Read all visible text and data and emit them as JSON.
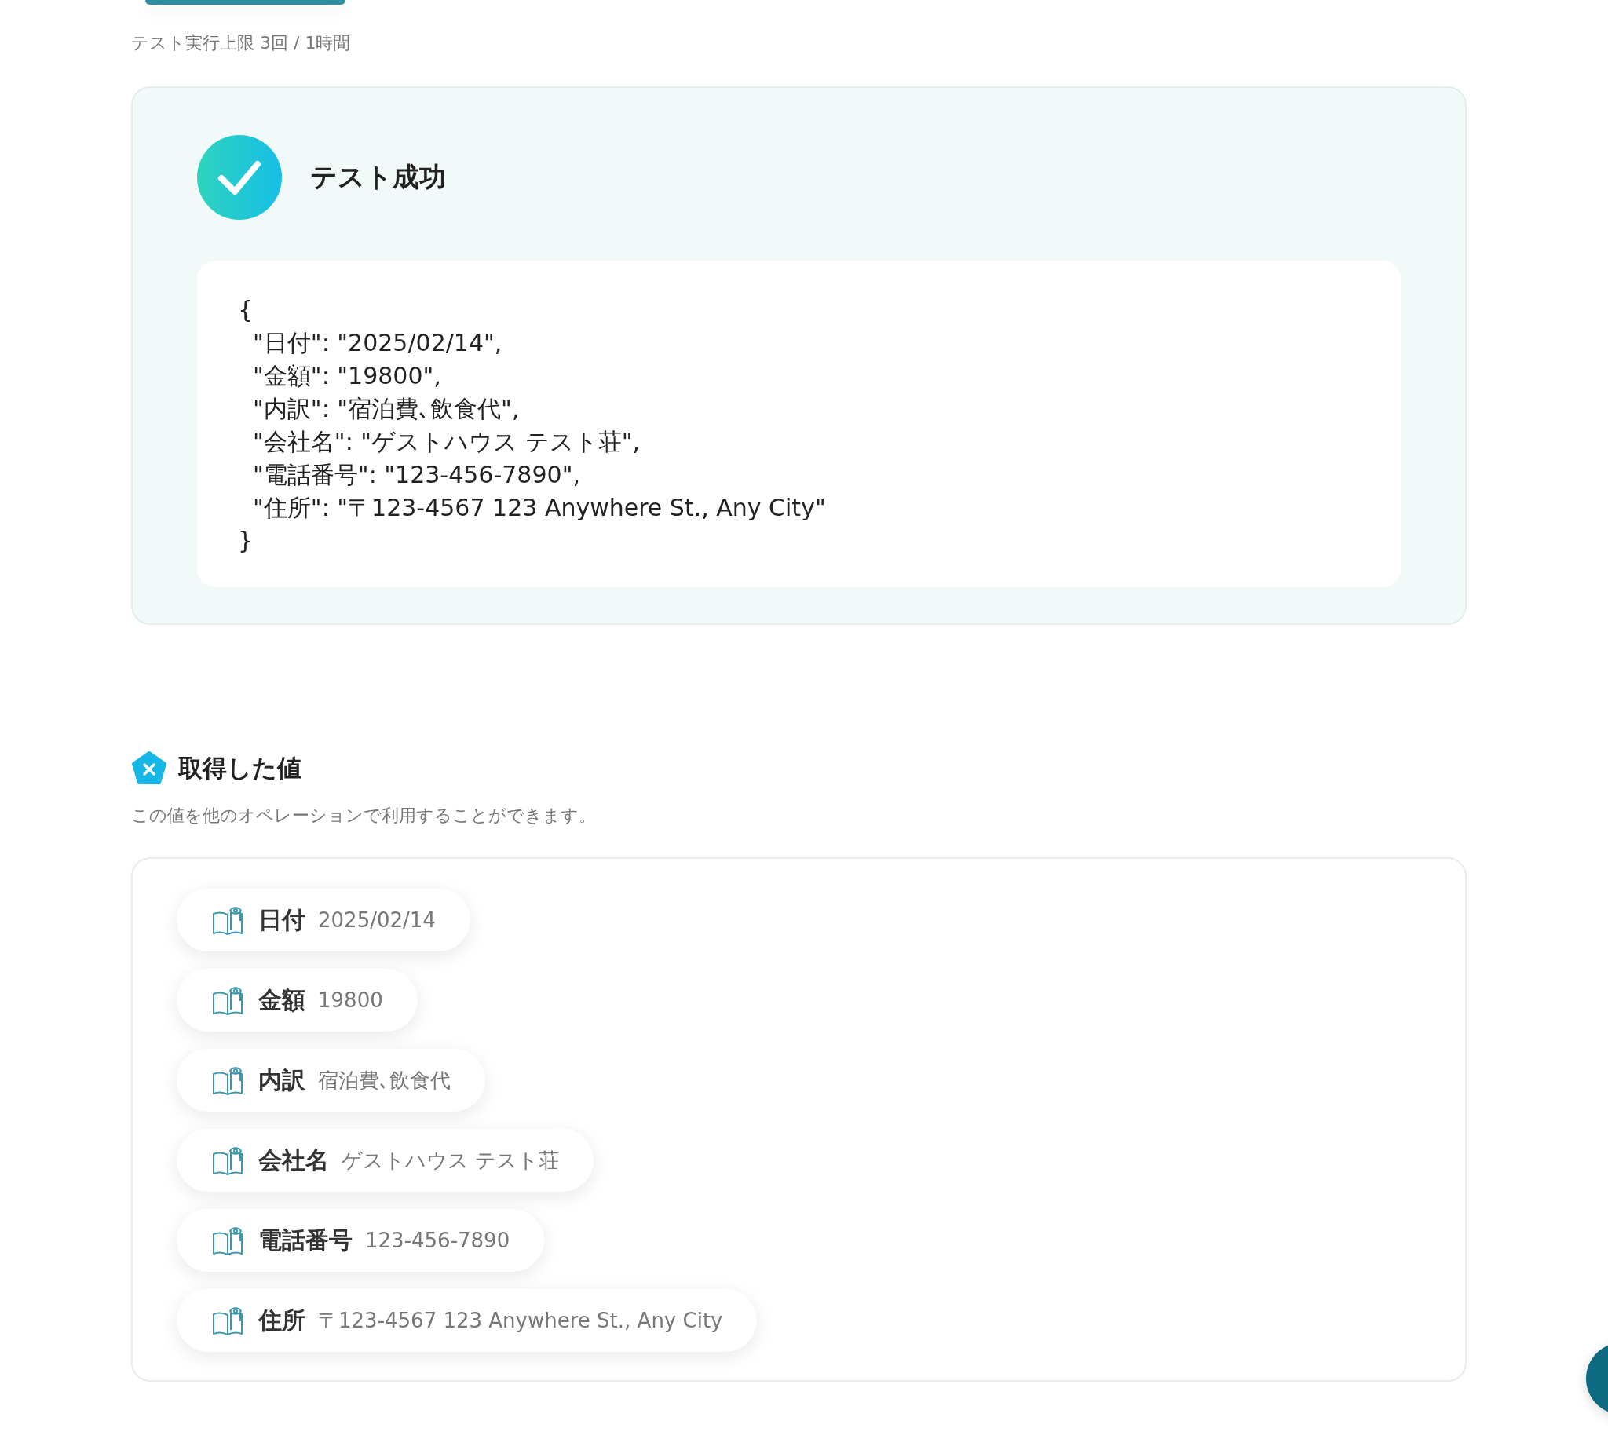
{
  "test_limit": "テスト実行上限 3回 / 1時間",
  "result": {
    "success": true,
    "title": "テスト成功",
    "code_lines": [
      "{",
      "  \"日付\": \"2025/02/14\",",
      "  \"金額\": \"19800\",",
      "  \"内訳\": \"宿泊費､飲食代\",",
      "  \"会社名\": \"ゲストハウス テスト荘\",",
      "  \"電話番号\": \"123-456-7890\",",
      "  \"住所\": \"〒123-4567 123 Anywhere St., Any City\"",
      "}"
    ]
  },
  "values_section": {
    "title": "取得した値",
    "description": "この値を他のオペレーションで利用することができます。",
    "items": [
      {
        "label": "日付",
        "value": "2025/02/14"
      },
      {
        "label": "金額",
        "value": "19800"
      },
      {
        "label": "内訳",
        "value": "宿泊費､飲食代"
      },
      {
        "label": "会社名",
        "value": "ゲストハウス テスト荘"
      },
      {
        "label": "電話番号",
        "value": "123-456-7890"
      },
      {
        "label": "住所",
        "value": "〒123-4567 123 Anywhere St., Any City"
      }
    ]
  }
}
